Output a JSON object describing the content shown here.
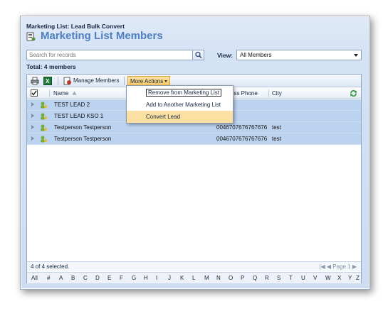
{
  "breadcrumb": "Marketing List: Lead Bulk Convert",
  "title": "Marketing List Members",
  "search": {
    "placeholder": "Search for records"
  },
  "view": {
    "label": "View:",
    "value": "All Members"
  },
  "total": "Total: 4 members",
  "toolbar": {
    "manage_label": "Manage Members",
    "more_actions_label": "More Actions"
  },
  "columns": {
    "name": "Name",
    "phone": "Business Phone",
    "city": "City"
  },
  "rows": [
    {
      "name": "TEST LEAD 2",
      "phone": "",
      "city": ""
    },
    {
      "name": "TEST LEAD KSO 1",
      "phone": "",
      "city": ""
    },
    {
      "name": "Testperson Testperson",
      "phone": "0046707676767676",
      "city": "test"
    },
    {
      "name": "Testperson Testperson",
      "phone": "0046707676767676",
      "city": "test"
    }
  ],
  "footer": {
    "selected": "4 of 4 selected.",
    "page": "Page 1"
  },
  "alphabet": [
    "All",
    "#",
    "A",
    "B",
    "C",
    "D",
    "E",
    "F",
    "G",
    "H",
    "I",
    "J",
    "K",
    "L",
    "M",
    "N",
    "O",
    "P",
    "Q",
    "R",
    "S",
    "T",
    "U",
    "V",
    "W",
    "X",
    "Y",
    "Z"
  ],
  "menu": {
    "remove": "Remove from Marketing List",
    "add": "Add to Another Marketing List",
    "convert": "Convert Lead"
  },
  "colors": {
    "accent": "#4e7fbf",
    "selected_row": "#bcd3ef",
    "menu_highlight": "#fbe0a3"
  }
}
